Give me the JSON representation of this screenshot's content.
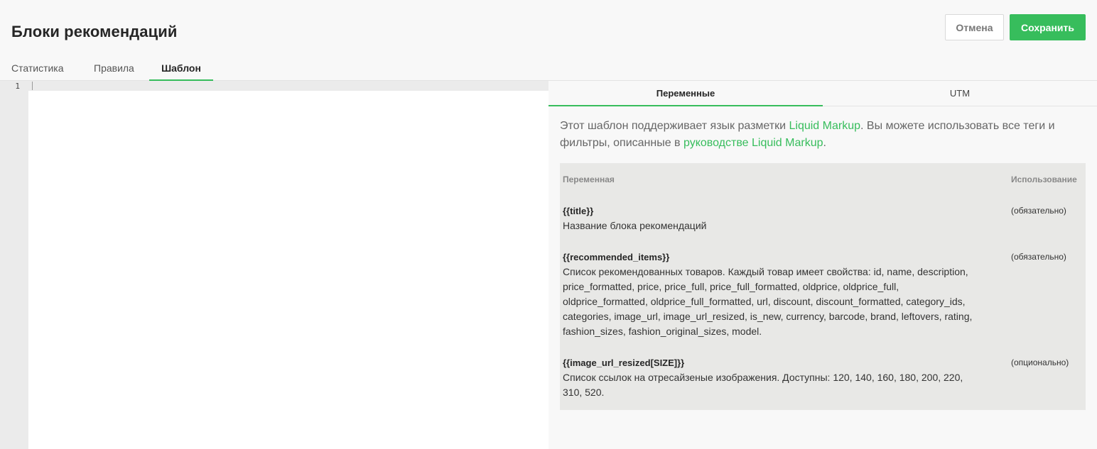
{
  "page": {
    "title": "Блоки рекомендаций",
    "cancel_label": "Отмена",
    "save_label": "Сохранить"
  },
  "tabs": [
    {
      "label": "Статистика",
      "active": false
    },
    {
      "label": "Правила",
      "active": false
    },
    {
      "label": "Шаблон",
      "active": true
    }
  ],
  "editor": {
    "line_numbers": [
      "1"
    ],
    "content": ""
  },
  "panel": {
    "tabs": [
      {
        "label": "Переменные",
        "active": true
      },
      {
        "label": "UTM",
        "active": false
      }
    ],
    "intro": {
      "part1": "Этот шаблон поддерживает язык разметки ",
      "link1": "Liquid Markup",
      "part2": ". Вы можете использовать все теги и фильтры, описанные в ",
      "link2": "руководстве Liquid Markup",
      "part3": "."
    },
    "table": {
      "col_variable": "Переменная",
      "col_usage": "Использование",
      "rows": [
        {
          "name": "{{title}}",
          "description": "Название блока рекомендаций",
          "usage": "(обязательно)"
        },
        {
          "name": "{{recommended_items}}",
          "description": "Список рекомендованных товаров. Каждый товар имеет свойства: id, name, description, price_formatted, price, price_full, price_full_formatted, oldprice, oldprice_full, oldprice_formatted, oldprice_full_formatted, url, discount, discount_formatted, category_ids, categories, image_url, image_url_resized, is_new, currency, barcode, brand, leftovers, rating, fashion_sizes, fashion_original_sizes, model.",
          "usage": "(обязательно)"
        },
        {
          "name": "{{image_url_resized[SIZE]}}",
          "description": "Список ссылок на отресайзеные изображения. Доступны: 120, 140, 160, 180, 200, 220, 310, 520.",
          "usage": "(опционально)"
        }
      ]
    }
  },
  "colors": {
    "accent": "#37bd5c",
    "background": "#f8f8f8",
    "table_background": "#e8e8e6"
  }
}
